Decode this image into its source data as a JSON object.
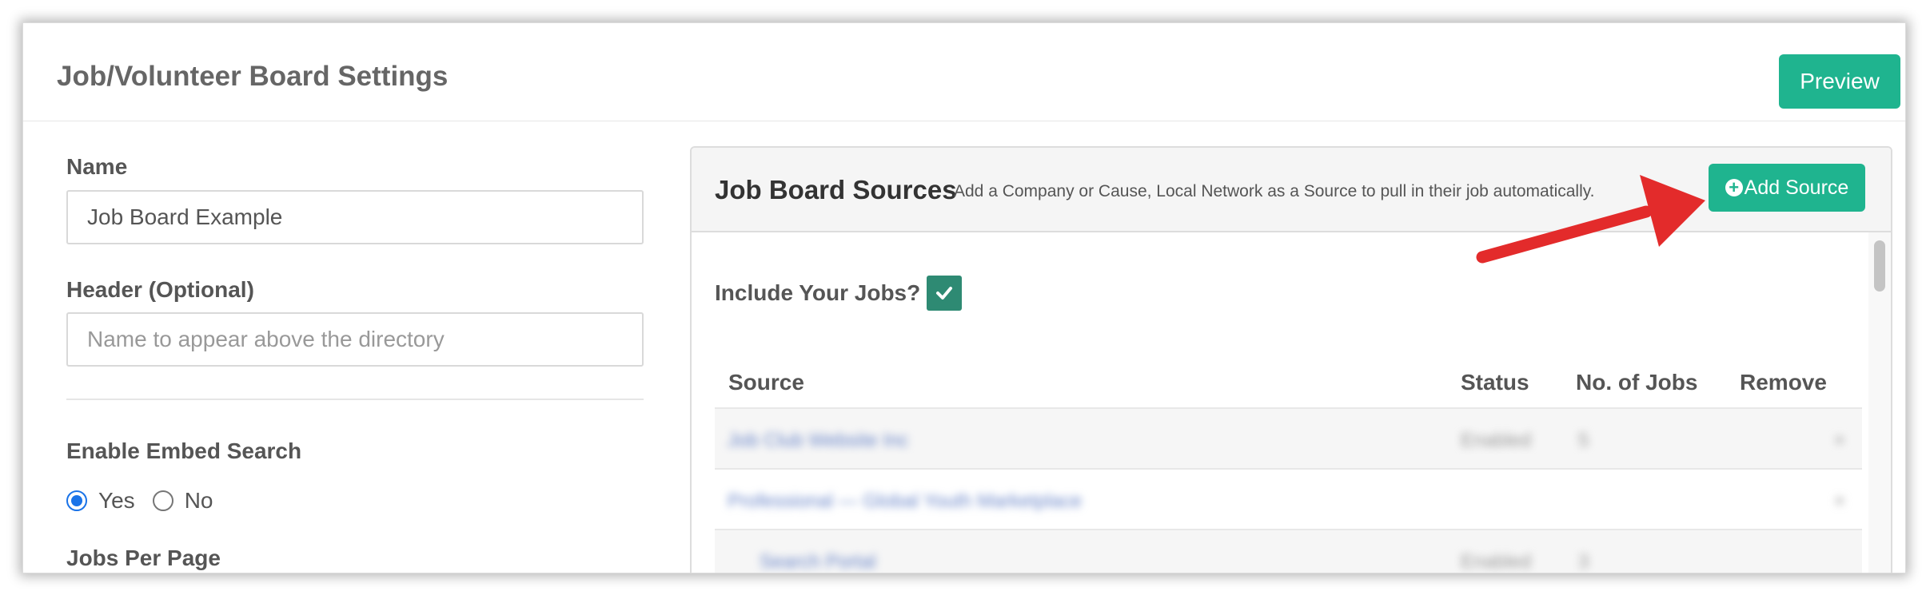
{
  "page": {
    "title": "Job/Volunteer Board Settings",
    "preview_label": "Preview"
  },
  "form": {
    "name_label": "Name",
    "name_value": "Job Board Example",
    "header_label": "Header (Optional)",
    "header_placeholder": "Name to appear above the directory",
    "embed_label": "Enable Embed Search",
    "embed_options": [
      "Yes",
      "No"
    ],
    "embed_selected": "Yes",
    "jobs_per_page_label": "Jobs Per Page"
  },
  "sources_panel": {
    "title": "Job Board Sources",
    "subtitle": "Add a Company or Cause, Local Network as a Source to pull in their job automatically.",
    "add_button_label": "Add Source",
    "include_label": "Include Your Jobs?",
    "include_checked": true,
    "columns": [
      "Source",
      "Status",
      "No. of Jobs",
      "Remove"
    ],
    "rows": [
      {
        "source": "Job Club Website Inc",
        "status": "Enabled",
        "jobs": "5",
        "remove": "×"
      },
      {
        "source": "Professional — Global Youth Marketplace",
        "status": "",
        "jobs": "",
        "remove": "×"
      },
      {
        "source": "Search Portal",
        "status": "Enabled",
        "jobs": "3",
        "remove": ""
      }
    ]
  },
  "colors": {
    "accent": "#1fb48f",
    "checkbox": "#2e8a73",
    "arrow": "#e32b2b"
  }
}
